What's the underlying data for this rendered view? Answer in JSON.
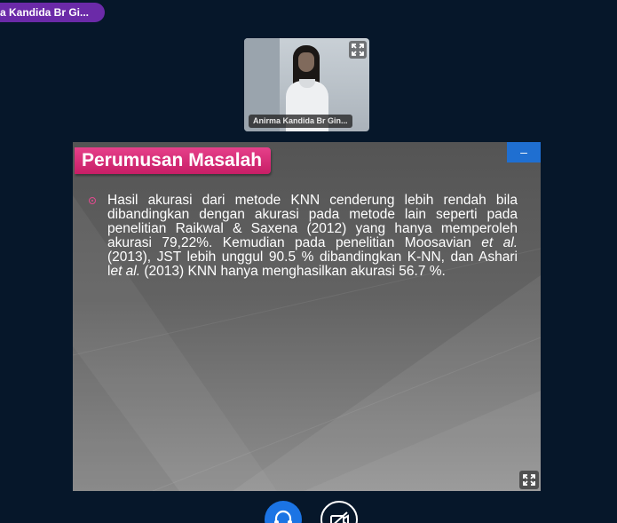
{
  "presenter": {
    "name": "a Kandida Br Gi..."
  },
  "webcam": {
    "name_tag": "Anirma Kandida Br Gin...",
    "expand_icon": "expand-icon"
  },
  "slide": {
    "title": "Perumusan Masalah",
    "bullet_text": "Hasil akurasi dari metode KNN cenderung lebih rendah bila dibandingkan dengan akurasi pada metode lain seperti pada penelitian Raikwal & Saxena (2012) yang hanya memperoleh akurasi 79,22%. Kemudian pada penelitian Moosavian et al. (2013), JST lebih unggul 90.5 % dibandingkan K-NN, dan Ashari let al. (2013) KNN hanya menghasilkan akurasi 56.7 %.",
    "bullet_parts": {
      "p1": "Hasil akurasi dari metode KNN cenderung lebih rendah bila dibandingkan dengan akurasi pada metode lain seperti pada penelitian Raikwal & Saxena (2012) yang hanya memperoleh akurasi 79,22%. Kemudian pada penelitian Moosavian ",
      "p2": "et al.",
      "p3": " (2013), JST lebih unggul 90.5 % dibandingkan K-NN, dan Ashari l",
      "p4": "et al.",
      "p5": " (2013) KNN hanya menghasilkan akurasi 56.7 %."
    },
    "minimize_label": "–",
    "accent_color": "#c81e66"
  },
  "controls": {
    "audio_icon": "headset-icon",
    "video_icon": "video-off-icon",
    "audio_color": "#1b74e4"
  }
}
